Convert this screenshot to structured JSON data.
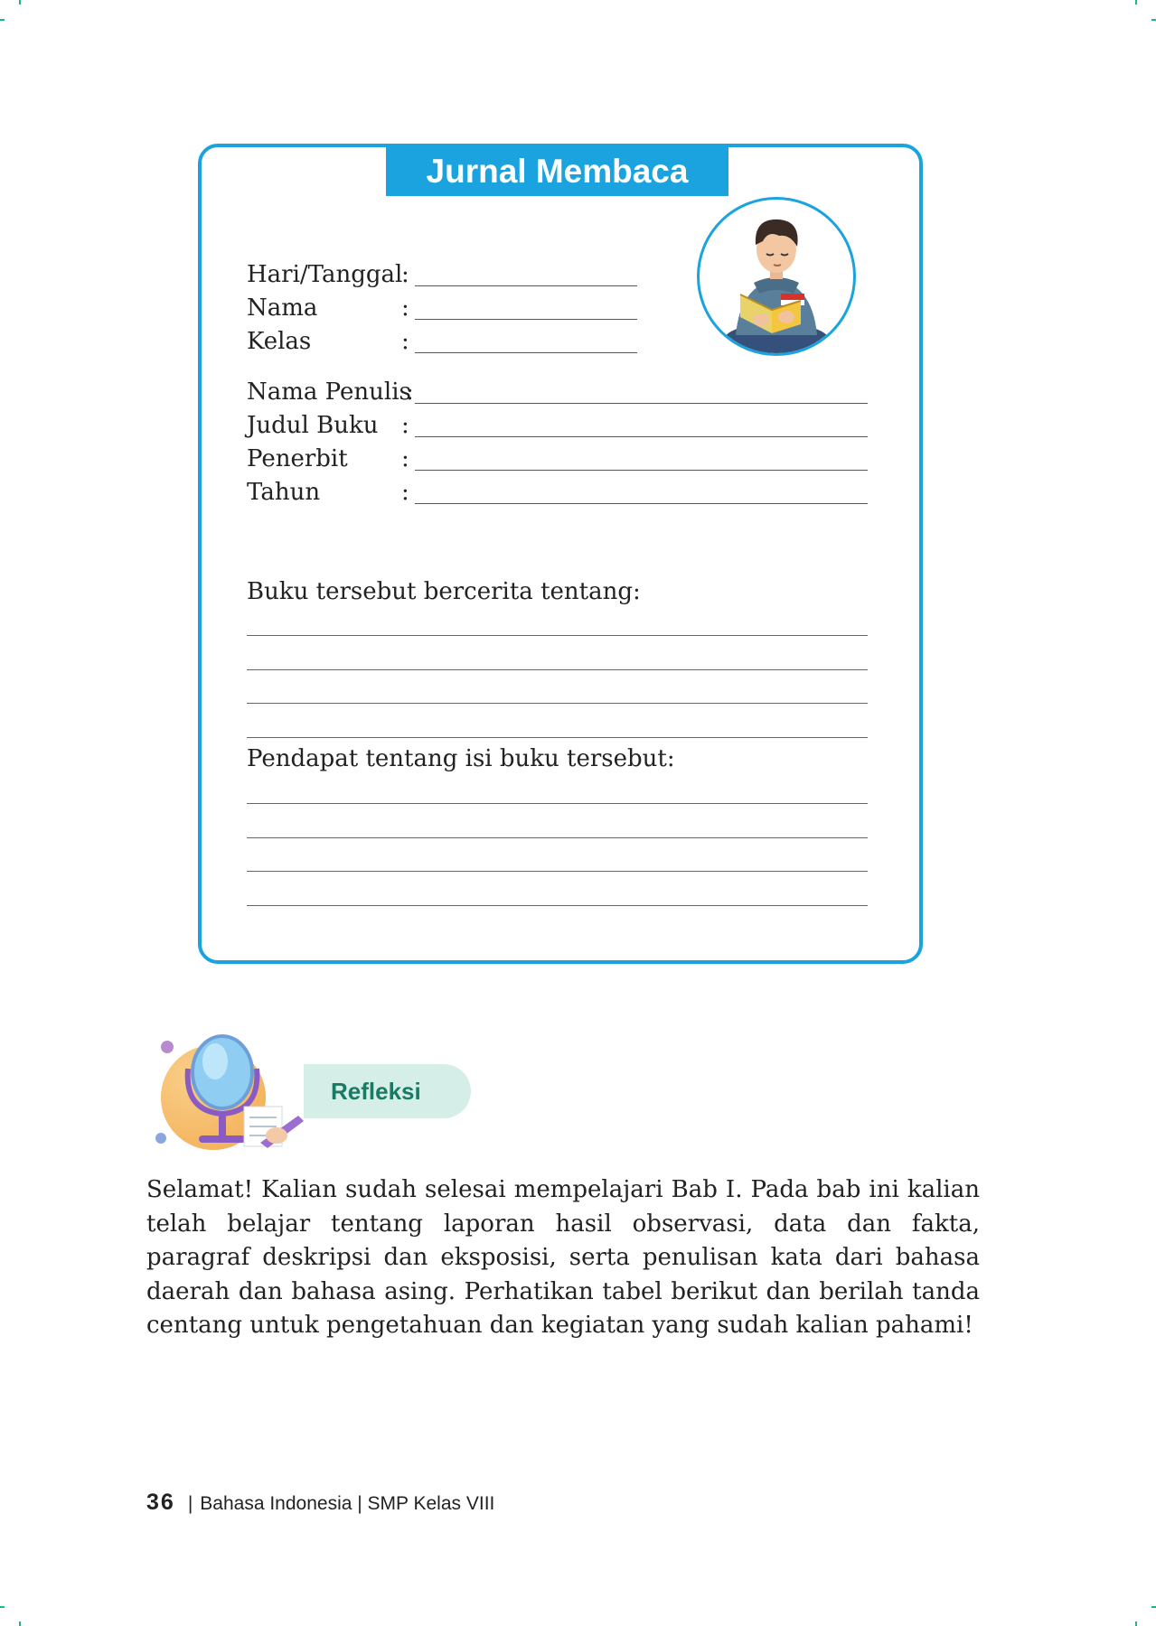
{
  "journal": {
    "title": "Jurnal Membaca",
    "fields_short": [
      {
        "label": "Hari/Tanggal",
        "colon": ":"
      },
      {
        "label": "Nama",
        "colon": ":"
      },
      {
        "label": "Kelas",
        "colon": ":"
      }
    ],
    "fields_long": [
      {
        "label": "Nama Penulis",
        "colon": ":"
      },
      {
        "label": "Judul Buku",
        "colon": ":"
      },
      {
        "label": "Penerbit",
        "colon": ":"
      },
      {
        "label": "Tahun",
        "colon": ":"
      }
    ],
    "story_prompt": "Buku tersebut bercerita tentang:",
    "opinion_prompt": "Pendapat tentang isi buku tersebut:"
  },
  "reflection": {
    "heading": "Refleksi",
    "paragraph": "Selamat! Kalian sudah selesai mempelajari Bab I. Pada bab ini kalian telah belajar tentang laporan hasil observasi, data dan fakta, paragraf deskripsi dan eksposisi, serta penulisan kata dari bahasa daerah dan bahasa asing. Perhatikan tabel berikut dan berilah tanda centang untuk pengetahuan dan kegiatan yang sudah kalian pahami!"
  },
  "footer": {
    "page_number": "36",
    "separator": "|",
    "book_title": "Bahasa Indonesia | SMP Kelas VIII"
  },
  "colors": {
    "journal_blue": "#1aa3de",
    "reflection_green": "#1a7a64",
    "reflection_pill": "#d5efe8",
    "crop_marks": "#1bb58a"
  }
}
